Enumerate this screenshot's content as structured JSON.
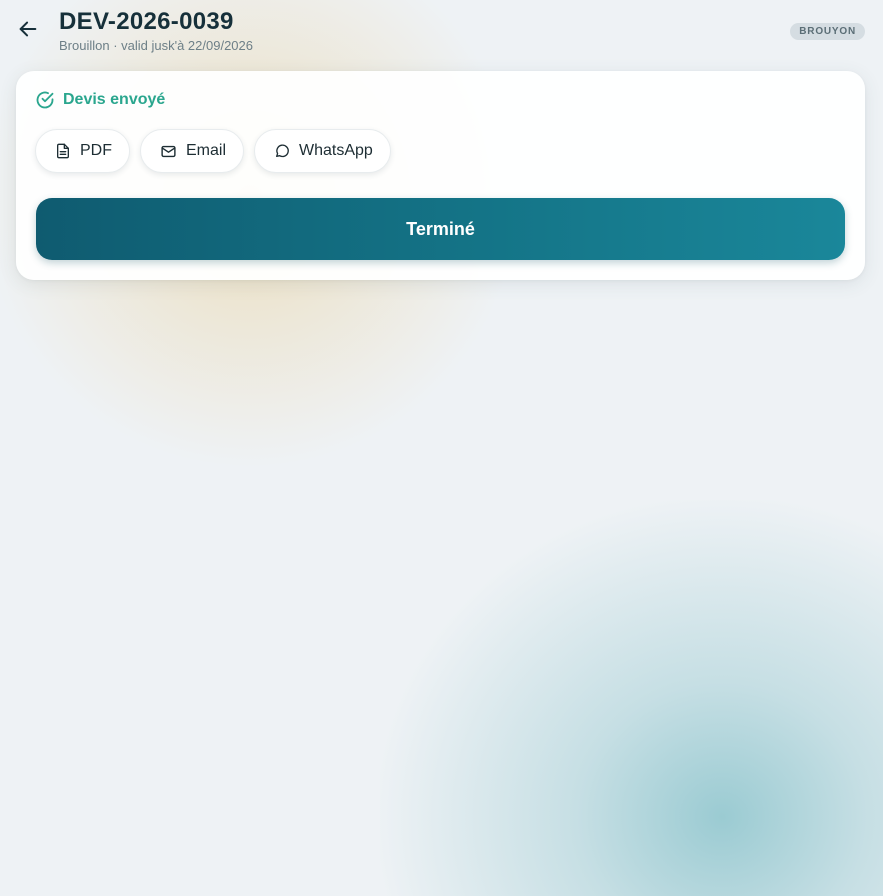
{
  "header": {
    "title": "DEV-2026-0039",
    "subtitle": "Brouillon · valid jusk'à 22/09/2026",
    "badge": "BROUYON",
    "back_icon": "arrow-left-icon"
  },
  "card": {
    "status": {
      "icon": "check-circle-icon",
      "label": "Devis envoyé",
      "color": "#2aa68e"
    },
    "share_buttons": [
      {
        "icon": "document-icon",
        "label": "PDF"
      },
      {
        "icon": "mail-icon",
        "label": "Email"
      },
      {
        "icon": "chat-bubble-icon",
        "label": "WhatsApp"
      }
    ],
    "done_label": "Terminé"
  },
  "colors": {
    "accent": "#147487",
    "success": "#2aa68e",
    "background": "#eef2f5"
  }
}
